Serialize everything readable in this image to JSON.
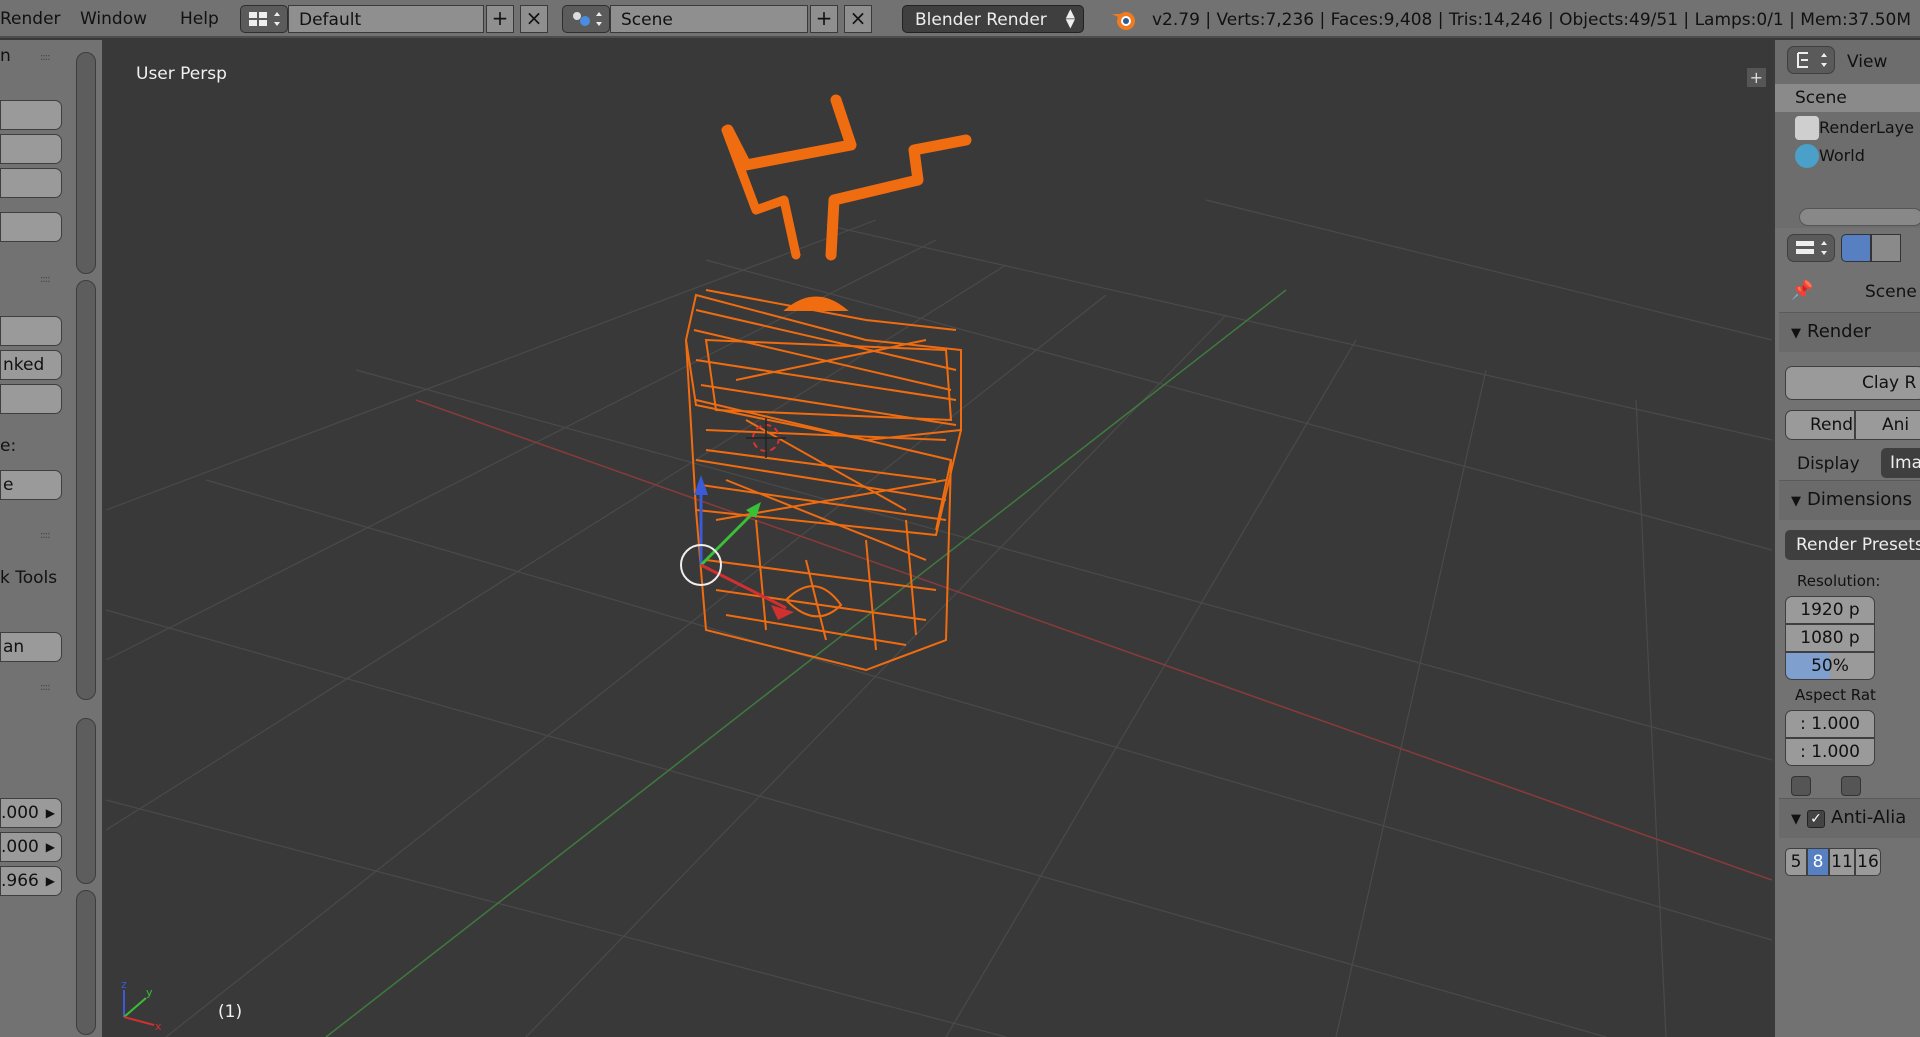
{
  "menu": [
    "Render",
    "Window",
    "Help"
  ],
  "layout": {
    "name": "Default"
  },
  "scene": {
    "name": "Scene"
  },
  "engine": {
    "label": "Blender Render"
  },
  "stats": "v2.79 | Verts:7,236 | Faces:9,408 | Tris:14,246 | Objects:49/51 | Lamps:0/1 | Mem:37.50M",
  "viewport": {
    "label": "User Persp",
    "frame": "(1)"
  },
  "left_panel": {
    "text_linked": "nked",
    "text_ve": "e:",
    "text_e": "e",
    "text_tools": "k Tools",
    "text_an": "an",
    "text_n": "n",
    "num1": ".000",
    "num2": ".000",
    "num3": ".966"
  },
  "outliner": {
    "view_label": "View",
    "items": [
      "Scene",
      "RenderLaye",
      "World"
    ]
  },
  "properties": {
    "context": "Scene",
    "render_header": "Render",
    "clay_label": "Clay R",
    "render_btn": "Rende",
    "anim_btn": "Ani",
    "display_label": "Display",
    "display_value": "Imag",
    "dimensions_header": "Dimensions",
    "presets": "Render Presets",
    "resolution_label": "Resolution:",
    "res_x": "1920 p",
    "res_y": "1080 p",
    "res_pct": "50%",
    "aspect_label": "Aspect Rat",
    "aspect_x": ": 1.000",
    "aspect_y": ": 1.000",
    "aa_header": "Anti-Alia",
    "aa_samples": [
      "5",
      "8",
      "11",
      "16"
    ]
  },
  "colors": {
    "accent": "#f06c10",
    "selected": "#5680c2"
  }
}
